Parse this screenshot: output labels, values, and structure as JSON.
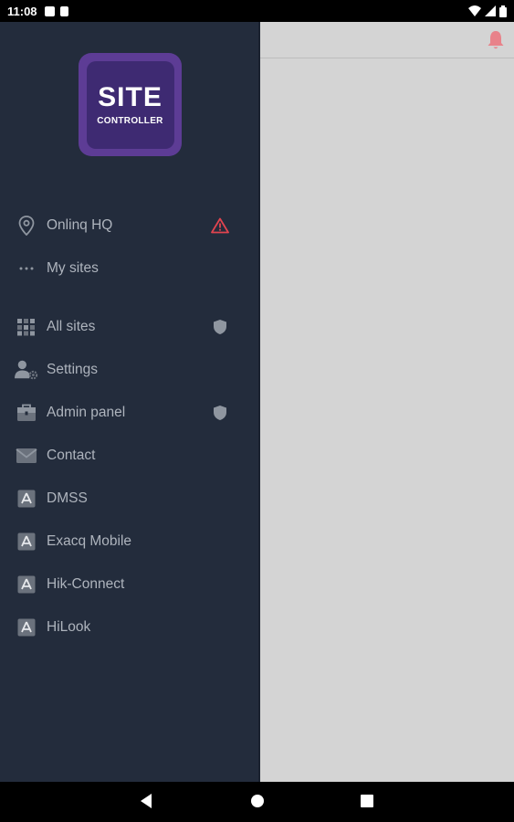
{
  "status_bar": {
    "time": "11:08"
  },
  "logo": {
    "line1": "SITE",
    "line2": "CONTROLLER"
  },
  "drawer": {
    "items": [
      {
        "label": "Onlinq HQ"
      },
      {
        "label": "My sites"
      },
      {
        "label": "All sites"
      },
      {
        "label": "Settings"
      },
      {
        "label": "Admin panel"
      },
      {
        "label": "Contact"
      },
      {
        "label": "DMSS"
      },
      {
        "label": "Exacq Mobile"
      },
      {
        "label": "Hik-Connect"
      },
      {
        "label": "HiLook"
      }
    ]
  },
  "colors": {
    "drawer_bg": "#232c3c",
    "accent_alert": "#e0444f",
    "logo": "#5d3c95",
    "bell": "#e8828a"
  },
  "icons": [
    "location-pin-icon",
    "warning-icon",
    "more-icon",
    "grid-icon",
    "shield-icon",
    "user-settings-icon",
    "toolbox-icon",
    "mail-icon",
    "app-store-icon",
    "bell-icon"
  ]
}
